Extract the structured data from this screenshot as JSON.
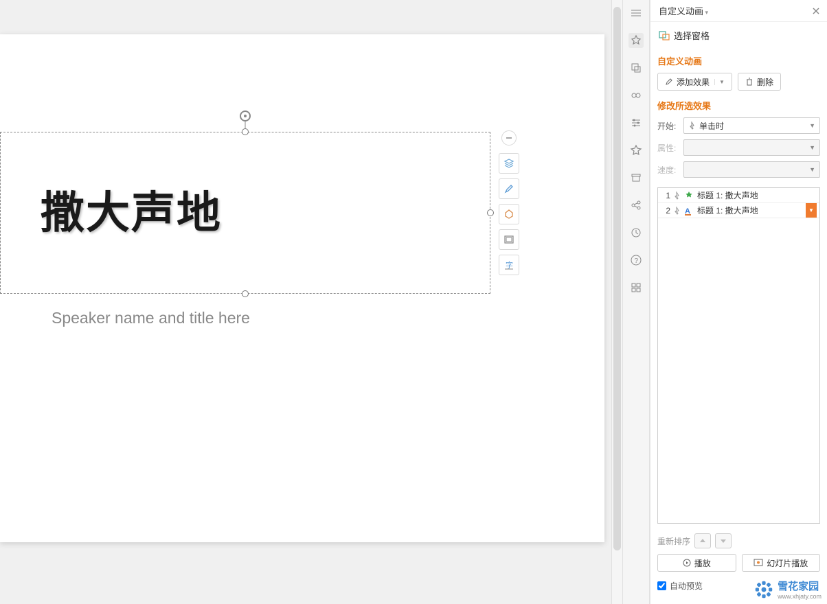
{
  "panel": {
    "title": "自定义动画",
    "select_pane": "选择窗格",
    "section_custom": "自定义动画",
    "add_effect": "添加效果",
    "delete": "删除",
    "section_modify": "修改所选效果",
    "start_label": "开始:",
    "start_value": "单击时",
    "prop_label": "属性:",
    "speed_label": "速度:",
    "reorder": "重新排序",
    "play": "播放",
    "slideshow": "幻灯片播放",
    "auto_preview": "自动预览"
  },
  "anim_list": [
    {
      "num": "1",
      "label": "标题 1: 撒大声地",
      "type": "entrance"
    },
    {
      "num": "2",
      "label": "标题 1: 撒大声地",
      "type": "emphasis",
      "selected": true
    }
  ],
  "slide": {
    "title": "撒大声地",
    "subtitle": "Speaker name and title here"
  },
  "watermark": {
    "name": "雪花家园",
    "url": "www.xhjaty.com"
  }
}
